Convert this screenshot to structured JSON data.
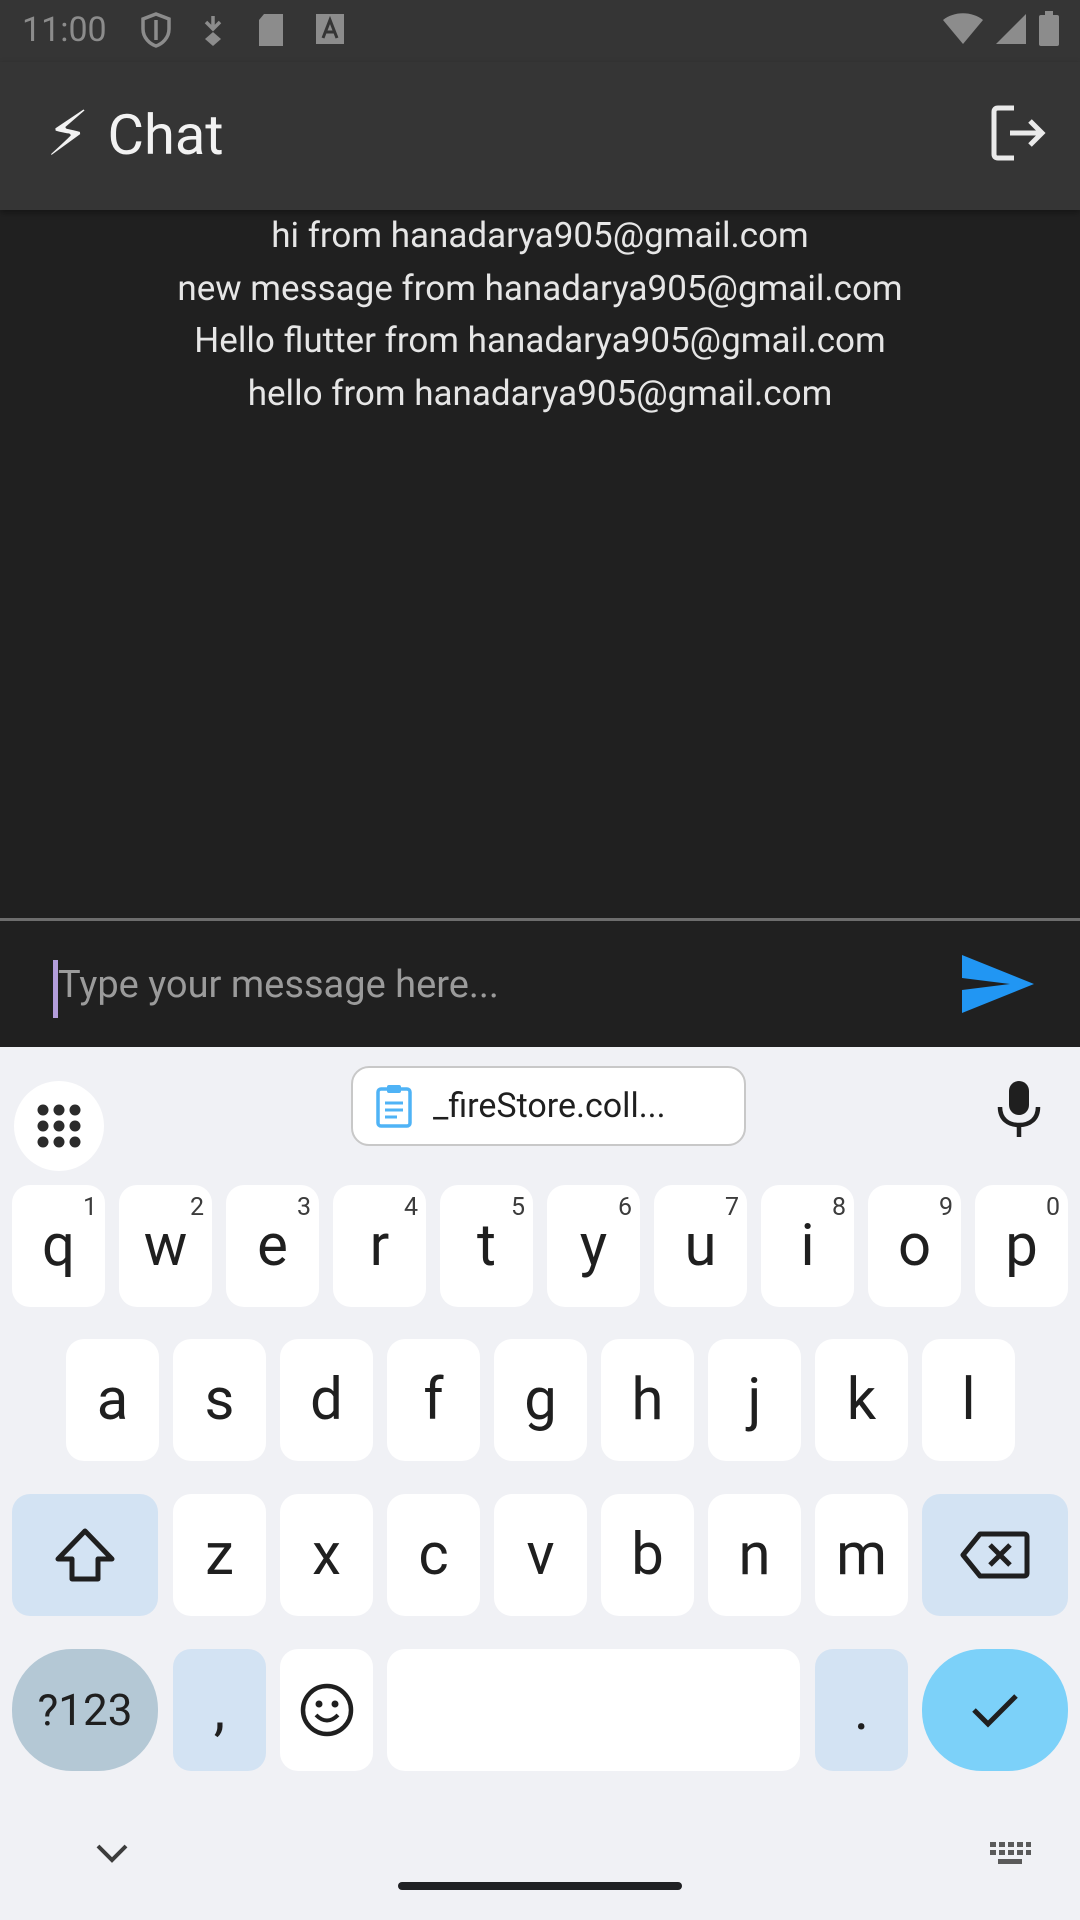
{
  "status_bar": {
    "time": "11:00",
    "left_icons": [
      "shield-icon",
      "download-icon",
      "sd-card-icon",
      "font-icon"
    ],
    "right_icons": [
      "wifi-icon",
      "signal-icon",
      "battery-icon"
    ]
  },
  "app_bar": {
    "icon": "⚡",
    "title": "Chat",
    "action_icon": "logout-icon"
  },
  "messages": [
    "hi from hanadarya905@gmail.com",
    "new message from hanadarya905@gmail.com",
    "Hello flutter from hanadarya905@gmail.com",
    "hello from hanadarya905@gmail.com"
  ],
  "composer": {
    "placeholder": "Type your message here...",
    "send_icon": "send-icon"
  },
  "keyboard": {
    "clipboard_suggestion": "_fireStore.coll...",
    "row1": [
      {
        "key": "q",
        "hint": "1"
      },
      {
        "key": "w",
        "hint": "2"
      },
      {
        "key": "e",
        "hint": "3"
      },
      {
        "key": "r",
        "hint": "4"
      },
      {
        "key": "t",
        "hint": "5"
      },
      {
        "key": "y",
        "hint": "6"
      },
      {
        "key": "u",
        "hint": "7"
      },
      {
        "key": "i",
        "hint": "8"
      },
      {
        "key": "o",
        "hint": "9"
      },
      {
        "key": "p",
        "hint": "0"
      }
    ],
    "row2": [
      "a",
      "s",
      "d",
      "f",
      "g",
      "h",
      "j",
      "k",
      "l"
    ],
    "row3": [
      "z",
      "x",
      "c",
      "v",
      "b",
      "n",
      "m"
    ],
    "symbols_label": "?123",
    "comma": ",",
    "period": "."
  },
  "colors": {
    "app_bar": "#353535",
    "background": "#202020",
    "send_accent": "#2196f3",
    "enter_key": "#7cd1f9"
  }
}
